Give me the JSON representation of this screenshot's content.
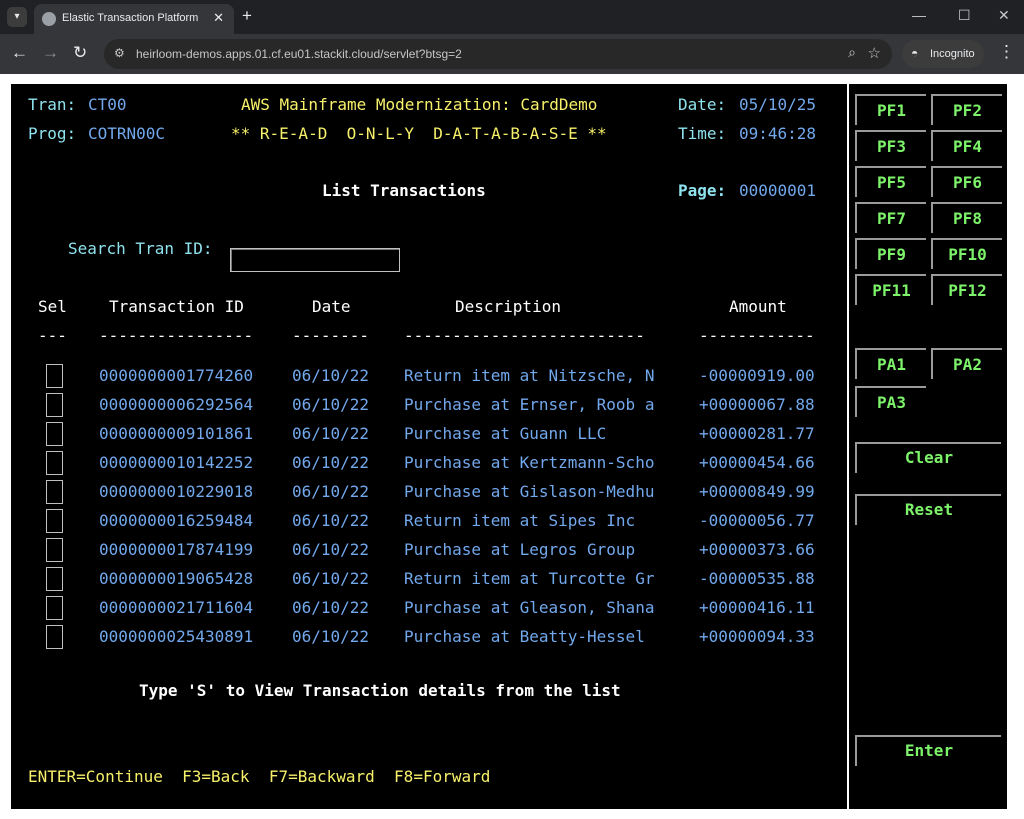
{
  "browser": {
    "tab_title": "Elastic Transaction Platform",
    "url": "heirloom-demos.apps.01.cf.eu01.stackit.cloud/servlet?btsg=2",
    "profile_label": "Incognito"
  },
  "header": {
    "tran_label": "Tran:",
    "tran_value": "CT00",
    "prog_label": "Prog:",
    "prog_value": "COTRN00C",
    "app_title": "AWS Mainframe Modernization: CardDemo",
    "readonly_notice": "** R-E-A-D  O-N-L-Y  D-A-T-A-B-A-S-E **",
    "date_label": "Date:",
    "date_value": "05/10/25",
    "time_label": "Time:",
    "time_value": "09:46:28"
  },
  "screen": {
    "title": "List Transactions",
    "page_label": "Page:",
    "page_value": "00000001",
    "search_label": "Search Tran ID:",
    "search_value": ""
  },
  "table": {
    "headers": {
      "sel": "Sel",
      "id": "Transaction ID",
      "date": "Date",
      "desc": "Description",
      "amount": "Amount"
    },
    "dashes": {
      "sel": "---",
      "id": "----------------",
      "date": "--------",
      "desc": "-------------------------",
      "amount": "------------"
    },
    "rows": [
      {
        "id": "0000000001774260",
        "date": "06/10/22",
        "desc": "Return item at Nitzsche, N",
        "amount": "-00000919.00"
      },
      {
        "id": "0000000006292564",
        "date": "06/10/22",
        "desc": "Purchase at Ernser, Roob a",
        "amount": "+00000067.88"
      },
      {
        "id": "0000000009101861",
        "date": "06/10/22",
        "desc": "Purchase at Guann LLC",
        "amount": "+00000281.77"
      },
      {
        "id": "0000000010142252",
        "date": "06/10/22",
        "desc": "Purchase at Kertzmann-Scho",
        "amount": "+00000454.66"
      },
      {
        "id": "0000000010229018",
        "date": "06/10/22",
        "desc": "Purchase at Gislason-Medhu",
        "amount": "+00000849.99"
      },
      {
        "id": "0000000016259484",
        "date": "06/10/22",
        "desc": "Return item at Sipes Inc",
        "amount": "-00000056.77"
      },
      {
        "id": "0000000017874199",
        "date": "06/10/22",
        "desc": "Purchase at Legros Group",
        "amount": "+00000373.66"
      },
      {
        "id": "0000000019065428",
        "date": "06/10/22",
        "desc": "Return item at Turcotte Gr",
        "amount": "-00000535.88"
      },
      {
        "id": "0000000021711604",
        "date": "06/10/22",
        "desc": "Purchase at Gleason, Shana",
        "amount": "+00000416.11"
      },
      {
        "id": "0000000025430891",
        "date": "06/10/22",
        "desc": "Purchase at Beatty-Hessel",
        "amount": "+00000094.33"
      }
    ]
  },
  "footer": {
    "instruction": "Type 'S' to View Transaction details from the list",
    "keys": "ENTER=Continue  F3=Back  F7=Backward  F8=Forward"
  },
  "keypad": {
    "pf": [
      "PF1",
      "PF2",
      "PF3",
      "PF4",
      "PF5",
      "PF6",
      "PF7",
      "PF8",
      "PF9",
      "PF10",
      "PF11",
      "PF12"
    ],
    "pa": [
      "PA1",
      "PA2",
      "PA3"
    ],
    "clear": "Clear",
    "reset": "Reset",
    "enter": "Enter"
  },
  "colors": {
    "labels": "#8fe3ee",
    "title": "#f7f06a",
    "values": "#72a8ec",
    "keys": "#7df36a"
  }
}
